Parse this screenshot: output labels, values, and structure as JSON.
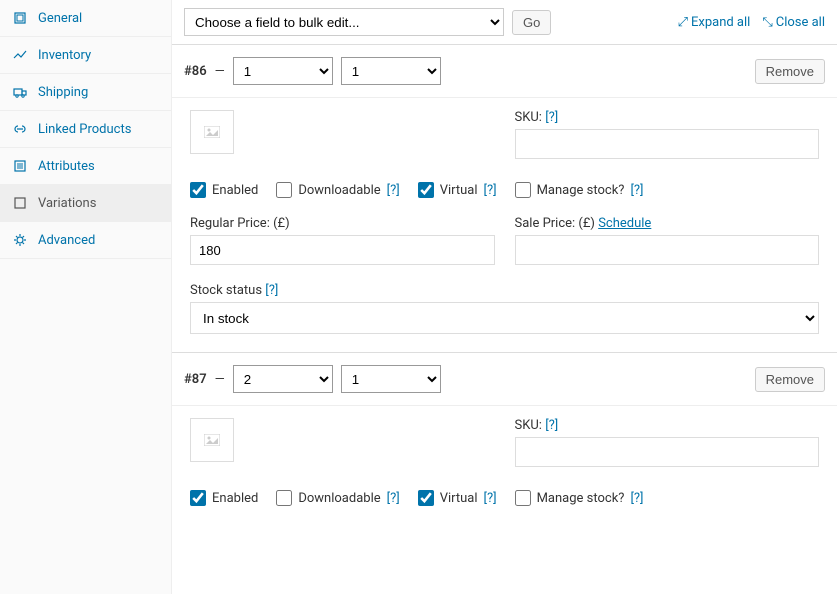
{
  "sidebar": {
    "items": [
      {
        "label": "General",
        "icon": "general"
      },
      {
        "label": "Inventory",
        "icon": "inventory"
      },
      {
        "label": "Shipping",
        "icon": "shipping"
      },
      {
        "label": "Linked Products",
        "icon": "linked"
      },
      {
        "label": "Attributes",
        "icon": "attributes"
      },
      {
        "label": "Variations",
        "icon": "variations"
      },
      {
        "label": "Advanced",
        "icon": "advanced"
      }
    ]
  },
  "toolbar": {
    "bulk_placeholder": "Choose a field to bulk edit...",
    "go": "Go",
    "expand": "Expand all",
    "close": "Close all"
  },
  "labels": {
    "sku": "SKU:",
    "help": "[?]",
    "enabled": "Enabled",
    "downloadable": "Downloadable",
    "virtual": "Virtual",
    "manage_stock": "Manage stock?",
    "regular_price": "Regular Price: (£)",
    "sale_price": "Sale Price: (£)",
    "schedule": "Schedule",
    "stock_status": "Stock status",
    "remove": "Remove",
    "in_stock": "In stock",
    "dash": " — "
  },
  "variations": [
    {
      "id": "#86",
      "attr1": "1",
      "attr2": "1",
      "sku": "",
      "enabled": true,
      "downloadable": false,
      "virtual": true,
      "manage_stock": false,
      "regular_price": "180",
      "sale_price": "",
      "stock_status": "In stock"
    },
    {
      "id": "#87",
      "attr1": "2",
      "attr2": "1",
      "sku": "",
      "enabled": true,
      "downloadable": false,
      "virtual": true,
      "manage_stock": false
    }
  ]
}
